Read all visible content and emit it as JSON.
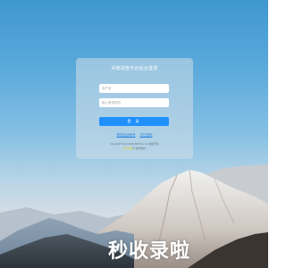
{
  "login": {
    "title": "问卷调查平台后台登录",
    "username_placeholder": "用户名",
    "password_placeholder": "输入登录密码",
    "login_button": "登 录",
    "links": [
      "修改后台帐号",
      "忘记密码"
    ],
    "copyright": "Copyright© Taxin 2016-2018 (Int. Ltd. 版权所有)",
    "footer_note_prefix": "沪ICP备",
    "footer_note": "号-技术支持"
  },
  "watermark": "秒收录啦",
  "colors": {
    "accent": "#1e90ff",
    "sky_top": "#3f97d0",
    "panel": "rgba(210,222,232,0.55)"
  }
}
